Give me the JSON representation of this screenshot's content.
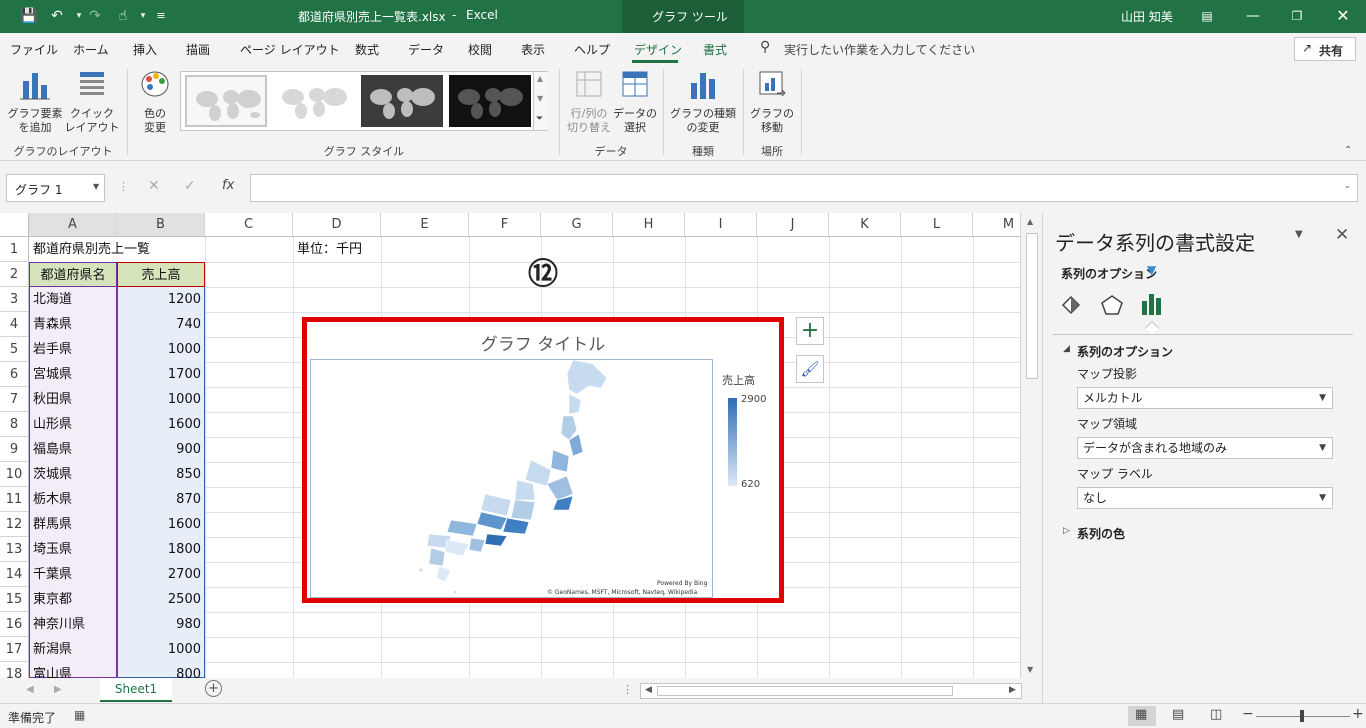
{
  "titlebar": {
    "filename": "都道府県別売上一覧表.xlsx",
    "dash": "-",
    "app": "Excel",
    "context_tab": "グラフ ツール",
    "user": "山田 知美"
  },
  "menu": {
    "items": [
      "ファイル",
      "ホーム",
      "挿入",
      "描画",
      "ページ レイアウト",
      "数式",
      "データ",
      "校閲",
      "表示",
      "ヘルプ",
      "デザイン",
      "書式"
    ],
    "tell_me": "実行したい作業を入力してください",
    "share": "共有"
  },
  "ribbon": {
    "add_element": [
      "グラフ要素",
      "を追加"
    ],
    "quick_layout": [
      "クイック",
      "レイアウト"
    ],
    "change_color": [
      "色の",
      "変更"
    ],
    "switch_rowcol": [
      "行/列の",
      "切り替え"
    ],
    "select_data": [
      "データの",
      "選択"
    ],
    "change_type": [
      "グラフの種類",
      "の変更"
    ],
    "move_chart": [
      "グラフの",
      "移動"
    ],
    "groups": {
      "layout": "グラフのレイアウト",
      "styles": "グラフ スタイル",
      "data": "データ",
      "type": "種類",
      "location": "場所"
    }
  },
  "formula": {
    "namebox": "グラフ 1",
    "fx": "fx",
    "value": ""
  },
  "columns": [
    "A",
    "B",
    "C",
    "D",
    "E",
    "F",
    "G",
    "H",
    "I",
    "J",
    "K",
    "L",
    "M"
  ],
  "rows": [
    "1",
    "2",
    "3",
    "4",
    "5",
    "6",
    "7",
    "8",
    "9",
    "10",
    "11",
    "12",
    "13",
    "14",
    "15",
    "16",
    "17",
    "18"
  ],
  "sheet": {
    "a1": "都道府県別売上一覧",
    "d1": "単位：千円",
    "hdr_a": "都道府県名",
    "hdr_b": "売上高",
    "data": [
      [
        "北海道",
        "1200"
      ],
      [
        "青森県",
        "740"
      ],
      [
        "岩手県",
        "1000"
      ],
      [
        "宮城県",
        "1700"
      ],
      [
        "秋田県",
        "1000"
      ],
      [
        "山形県",
        "1600"
      ],
      [
        "福島県",
        "900"
      ],
      [
        "茨城県",
        "850"
      ],
      [
        "栃木県",
        "870"
      ],
      [
        "群馬県",
        "1600"
      ],
      [
        "埼玉県",
        "1800"
      ],
      [
        "千葉県",
        "2700"
      ],
      [
        "東京都",
        "2500"
      ],
      [
        "神奈川県",
        "980"
      ],
      [
        "新潟県",
        "1000"
      ],
      [
        "富山県",
        "800"
      ]
    ]
  },
  "chart": {
    "title": "グラフ タイトル",
    "legend_title": "売上高",
    "legend_max": "2900",
    "legend_min": "620",
    "powered": "Powered By Bing",
    "credit": "© GeoNames, MSFT, Microsoft, Navteq, Wikipedia",
    "step": "⑫",
    "accent": "#e00000",
    "scale_dark": "#2f6db5",
    "scale_light": "#dde9f6"
  },
  "pane": {
    "title": "データ系列の書式設定",
    "options_menu": "系列のオプション",
    "section": "系列のオプション",
    "projection_label": "マップ投影",
    "projection_value": "メルカトル",
    "area_label": "マップ領域",
    "area_value": "データが含まれる地域のみ",
    "labels_label": "マップ ラベル",
    "labels_value": "なし",
    "color_section": "系列の色"
  },
  "sheet_tab": "Sheet1",
  "status": {
    "ready": "準備完了"
  }
}
